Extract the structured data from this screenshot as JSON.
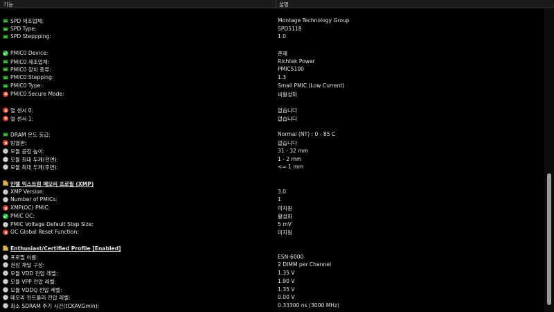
{
  "header": {
    "col_feature": "기능",
    "col_desc": "설명"
  },
  "rows": [
    {
      "type": "blank"
    },
    {
      "type": "item",
      "icon": "chip-icon",
      "label": "SPD 제조업체:",
      "value": "Montage Technology Group"
    },
    {
      "type": "item",
      "icon": "chip-icon",
      "label": "SPD Type:",
      "value": "SPD5118"
    },
    {
      "type": "item",
      "icon": "chip-icon",
      "label": "SPD Steppping:",
      "value": "1.0"
    },
    {
      "type": "blank"
    },
    {
      "type": "item",
      "icon": "check-icon",
      "label": "PMIC0 Device:",
      "value": "존재"
    },
    {
      "type": "item",
      "icon": "chip-icon",
      "label": "PMIC0 제조업체:",
      "value": "Richtek Power"
    },
    {
      "type": "item",
      "icon": "chip-icon",
      "label": "PMIC0 장치 종류:",
      "value": "PMIC5100"
    },
    {
      "type": "item",
      "icon": "chip-icon",
      "label": "PMIC0 Stepping:",
      "value": "1.3"
    },
    {
      "type": "item",
      "icon": "chip-icon",
      "label": "PMIC0 Type:",
      "value": "Small PMIC (Low Current)"
    },
    {
      "type": "item",
      "icon": "error-icon",
      "label": "PMIC0 Secure Mode:",
      "value": "비활성화"
    },
    {
      "type": "blank"
    },
    {
      "type": "item",
      "icon": "error-icon",
      "label": "열 센서 0:",
      "value": "없습니다"
    },
    {
      "type": "item",
      "icon": "error-icon",
      "label": "열 센서 1:",
      "value": "없습니다"
    },
    {
      "type": "blank"
    },
    {
      "type": "item",
      "icon": "chip-icon",
      "label": "DRAM 온도 등급:",
      "value": "Normal (NT) : 0 - 85 C"
    },
    {
      "type": "item",
      "icon": "error-icon",
      "label": "방열판:",
      "value": "없습니다"
    },
    {
      "type": "item",
      "icon": "info-icon",
      "label": "모듈 공칭 높이:",
      "value": "31 - 32 mm"
    },
    {
      "type": "item",
      "icon": "info-icon",
      "label": "모듈 최대 두께(전면):",
      "value": "1 - 2 mm"
    },
    {
      "type": "item",
      "icon": "info-icon",
      "label": "모듈 최대 두께(후면):",
      "value": "<= 1 mm"
    },
    {
      "type": "blank"
    },
    {
      "type": "section",
      "icon": "folder-icon",
      "label": "인텔 익스트림 메모리 프로필 (XMP)",
      "value": ""
    },
    {
      "type": "item",
      "icon": "info-icon",
      "label": "XMP Version:",
      "value": "3.0"
    },
    {
      "type": "item",
      "icon": "info-icon",
      "label": "Number of PMICs:",
      "value": "1"
    },
    {
      "type": "item",
      "icon": "error-icon",
      "label": "XMP(OC) PMIC:",
      "value": "미지원"
    },
    {
      "type": "item",
      "icon": "check-icon",
      "label": "PMIC OC:",
      "value": "활성화"
    },
    {
      "type": "item",
      "icon": "info-icon",
      "label": "PMIC Voltage Default Step Size:",
      "value": "5 mV"
    },
    {
      "type": "item",
      "icon": "error-icon",
      "label": "OC Global Reset Function:",
      "value": "미지원"
    },
    {
      "type": "blank"
    },
    {
      "type": "section",
      "icon": "folder-icon",
      "label": "Enthusiast/Certified Profile [Enabled]",
      "value": ""
    },
    {
      "type": "item",
      "icon": "info-icon",
      "label": "프로필 이름:",
      "value": "ESN-6000"
    },
    {
      "type": "item",
      "icon": "info-icon",
      "label": "권장 채널 구성:",
      "value": "2 DIMM per Channel"
    },
    {
      "type": "item",
      "icon": "info-icon",
      "label": "모듈 VDD 전압 레벨:",
      "value": "1.35 V"
    },
    {
      "type": "item",
      "icon": "info-icon",
      "label": "모듈 VPP 전압 레벨:",
      "value": "1.90 V"
    },
    {
      "type": "item",
      "icon": "info-icon",
      "label": "모듈 VDDQ 전압 레벨:",
      "value": "1.35 V"
    },
    {
      "type": "item",
      "icon": "info-icon",
      "label": "메모리 컨트롤러 전압 레벨:",
      "value": "0.00 V"
    },
    {
      "type": "item",
      "icon": "info-icon",
      "label": "최소 SDRAM 주기 시간(tCKAVGmin):",
      "value": "0.33300 ns (3000 MHz)"
    }
  ]
}
